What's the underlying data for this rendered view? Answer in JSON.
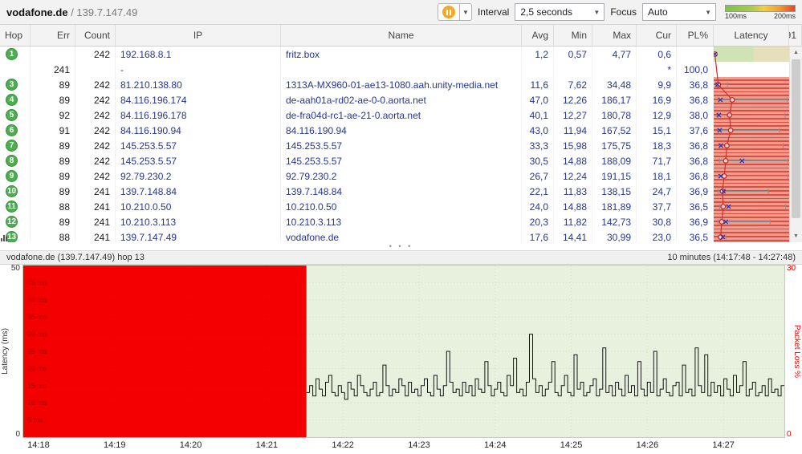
{
  "toolbar": {
    "target_name": "vodafone.de",
    "target_ip": " / 139.7.147.49",
    "interval_label": "Interval",
    "interval_value": "2,5 seconds",
    "focus_label": "Focus",
    "focus_value": "Auto",
    "legend_labels": [
      "100ms",
      "200ms"
    ],
    "legend_colors": [
      "#7fc24c",
      "#f59b2c",
      "#ef4123"
    ]
  },
  "table": {
    "scale_max": "191",
    "columns": [
      "Hop",
      "Err",
      "Count",
      "IP",
      "Name",
      "Avg",
      "Min",
      "Max",
      "Cur",
      "PL%",
      "Latency"
    ],
    "rows": [
      {
        "hop": "1",
        "graphed": false,
        "err": "",
        "count": "242",
        "ip": "192.168.8.1",
        "name": "fritz.box",
        "avg": "1,2",
        "min": "0,57",
        "max": "4,77",
        "cur": "0,6",
        "pl": "",
        "loss": false,
        "n": {
          "avg": 1.2,
          "min": 0.57,
          "max": 4.77,
          "cur": 0.6
        }
      },
      {
        "hop": "",
        "graphed": false,
        "err": "241",
        "count": "",
        "ip": "-",
        "name": "",
        "avg": "",
        "min": "",
        "max": "",
        "cur": "*",
        "pl": "100,0",
        "loss": true,
        "n": null
      },
      {
        "hop": "3",
        "graphed": false,
        "err": "89",
        "count": "242",
        "ip": "81.210.138.80",
        "name": "1313A-MX960-01-ae13-1080.aah.unity-media.net",
        "avg": "11,6",
        "min": "7,62",
        "max": "34,48",
        "cur": "9,9",
        "pl": "36,8",
        "loss": true,
        "n": {
          "avg": 11.6,
          "min": 7.62,
          "max": 34.48,
          "cur": 9.9
        }
      },
      {
        "hop": "4",
        "graphed": false,
        "err": "89",
        "count": "242",
        "ip": "84.116.196.174",
        "name": "de-aah01a-rd02-ae-0-0.aorta.net",
        "avg": "47,0",
        "min": "12,26",
        "max": "186,17",
        "cur": "16,9",
        "pl": "36,8",
        "loss": true,
        "n": {
          "avg": 47.0,
          "min": 12.26,
          "max": 186.17,
          "cur": 16.9
        }
      },
      {
        "hop": "5",
        "graphed": false,
        "err": "92",
        "count": "242",
        "ip": "84.116.196.178",
        "name": "de-fra04d-rc1-ae-21-0.aorta.net",
        "avg": "40,1",
        "min": "12,27",
        "max": "180,78",
        "cur": "12,9",
        "pl": "38,0",
        "loss": true,
        "n": {
          "avg": 40.1,
          "min": 12.27,
          "max": 180.78,
          "cur": 12.9
        }
      },
      {
        "hop": "6",
        "graphed": false,
        "err": "91",
        "count": "242",
        "ip": "84.116.190.94",
        "name": "84.116.190.94",
        "avg": "43,0",
        "min": "11,94",
        "max": "167,52",
        "cur": "15,1",
        "pl": "37,6",
        "loss": true,
        "n": {
          "avg": 43.0,
          "min": 11.94,
          "max": 167.52,
          "cur": 15.1
        }
      },
      {
        "hop": "7",
        "graphed": false,
        "err": "89",
        "count": "242",
        "ip": "145.253.5.57",
        "name": "145.253.5.57",
        "avg": "33,3",
        "min": "15,98",
        "max": "175,75",
        "cur": "18,3",
        "pl": "36,8",
        "loss": true,
        "n": {
          "avg": 33.3,
          "min": 15.98,
          "max": 175.75,
          "cur": 18.3
        }
      },
      {
        "hop": "8",
        "graphed": false,
        "err": "89",
        "count": "242",
        "ip": "145.253.5.57",
        "name": "145.253.5.57",
        "avg": "30,5",
        "min": "14,88",
        "max": "188,09",
        "cur": "71,7",
        "pl": "36,8",
        "loss": true,
        "n": {
          "avg": 30.5,
          "min": 14.88,
          "max": 188.09,
          "cur": 71.7
        }
      },
      {
        "hop": "9",
        "graphed": false,
        "err": "89",
        "count": "242",
        "ip": "92.79.230.2",
        "name": "92.79.230.2",
        "avg": "26,7",
        "min": "12,24",
        "max": "191,15",
        "cur": "18,1",
        "pl": "36,8",
        "loss": true,
        "n": {
          "avg": 26.7,
          "min": 12.24,
          "max": 191.15,
          "cur": 18.1
        }
      },
      {
        "hop": "10",
        "graphed": false,
        "err": "89",
        "count": "241",
        "ip": "139.7.148.84",
        "name": "139.7.148.84",
        "avg": "22,1",
        "min": "11,83",
        "max": "138,15",
        "cur": "24,7",
        "pl": "36,9",
        "loss": true,
        "n": {
          "avg": 22.1,
          "min": 11.83,
          "max": 138.15,
          "cur": 24.7
        }
      },
      {
        "hop": "11",
        "graphed": false,
        "err": "88",
        "count": "241",
        "ip": "10.210.0.50",
        "name": "10.210.0.50",
        "avg": "24,0",
        "min": "14,88",
        "max": "181,89",
        "cur": "37,7",
        "pl": "36,5",
        "loss": true,
        "n": {
          "avg": 24.0,
          "min": 14.88,
          "max": 181.89,
          "cur": 37.7
        }
      },
      {
        "hop": "12",
        "graphed": false,
        "err": "89",
        "count": "241",
        "ip": "10.210.3.113",
        "name": "10.210.3.113",
        "avg": "20,3",
        "min": "11,82",
        "max": "142,73",
        "cur": "30,8",
        "pl": "36,9",
        "loss": true,
        "n": {
          "avg": 20.3,
          "min": 11.82,
          "max": 142.73,
          "cur": 30.8
        }
      },
      {
        "hop": "13",
        "graphed": true,
        "err": "88",
        "count": "241",
        "ip": "139.7.147.49",
        "name": "vodafone.de",
        "avg": "17,6",
        "min": "14,41",
        "max": "30,99",
        "cur": "23,0",
        "pl": "36,5",
        "loss": true,
        "n": {
          "avg": 17.6,
          "min": 14.41,
          "max": 30.99,
          "cur": 23.0
        }
      }
    ]
  },
  "splitter_grip": "• • •",
  "focus_graph": {
    "title": "vodafone.de (139.7.147.49) hop 13",
    "range_label": "10 minutes (14:17:48 - 14:27:48)",
    "left_axis_label": "Latency (ms)",
    "right_axis_label": "Packet Loss %",
    "left_max": "50",
    "left_min": "0",
    "right_max": "30",
    "right_min": "0"
  },
  "chart_data": {
    "type": "line",
    "title": "vodafone.de (139.7.147.49) hop 13",
    "ylabel": "Latency (ms)",
    "y2label": "Packet Loss %",
    "ylim": [
      0,
      50
    ],
    "y2lim": [
      0,
      30
    ],
    "x_ticks": [
      "14:18",
      "14:19",
      "14:20",
      "14:21",
      "14:22",
      "14:23",
      "14:24",
      "14:25",
      "14:26",
      "14:27"
    ],
    "time_window": "14:17:48 - 14:27:48",
    "sample_interval_seconds": 2.5,
    "packet_loss_region": {
      "end_frac": 0.372,
      "loss_pct": 100
    },
    "grid_labels": [
      "45 ms",
      "40 ms",
      "35 ms",
      "30 ms",
      "25 ms",
      "20 ms",
      "15 ms",
      "10 ms",
      "5 ms"
    ],
    "latency_scale_max": 191,
    "latency_values": [
      13,
      15,
      12,
      17,
      14,
      12,
      16,
      18,
      13,
      12,
      15,
      13,
      11,
      16,
      14,
      12,
      18,
      15,
      13,
      12,
      14,
      16,
      12,
      13,
      21,
      15,
      12,
      14,
      13,
      17,
      15,
      12,
      16,
      13,
      14,
      12,
      15,
      17,
      13,
      12,
      18,
      14,
      12,
      15,
      25,
      16,
      13,
      14,
      12,
      16,
      13,
      15,
      12,
      17,
      14,
      13,
      22,
      15,
      12,
      14,
      16,
      13,
      12,
      18,
      15,
      23,
      13,
      14,
      12,
      16,
      30,
      17,
      13,
      15,
      12,
      14,
      16,
      22,
      13,
      12,
      15,
      18,
      13,
      12,
      24,
      14,
      16,
      12,
      13,
      15,
      17,
      12,
      14,
      26,
      13,
      15,
      12,
      16,
      14,
      12,
      18,
      13,
      15,
      12,
      22,
      14,
      12,
      16,
      13,
      25,
      12,
      14,
      17,
      13,
      12,
      15,
      16,
      12,
      21,
      13,
      14,
      12,
      26,
      15,
      13,
      24,
      12,
      16,
      13,
      15,
      12,
      17,
      14,
      12,
      18,
      13,
      15,
      22,
      12,
      14,
      16,
      12,
      13,
      15,
      12,
      17,
      13,
      14,
      12,
      15
    ]
  }
}
